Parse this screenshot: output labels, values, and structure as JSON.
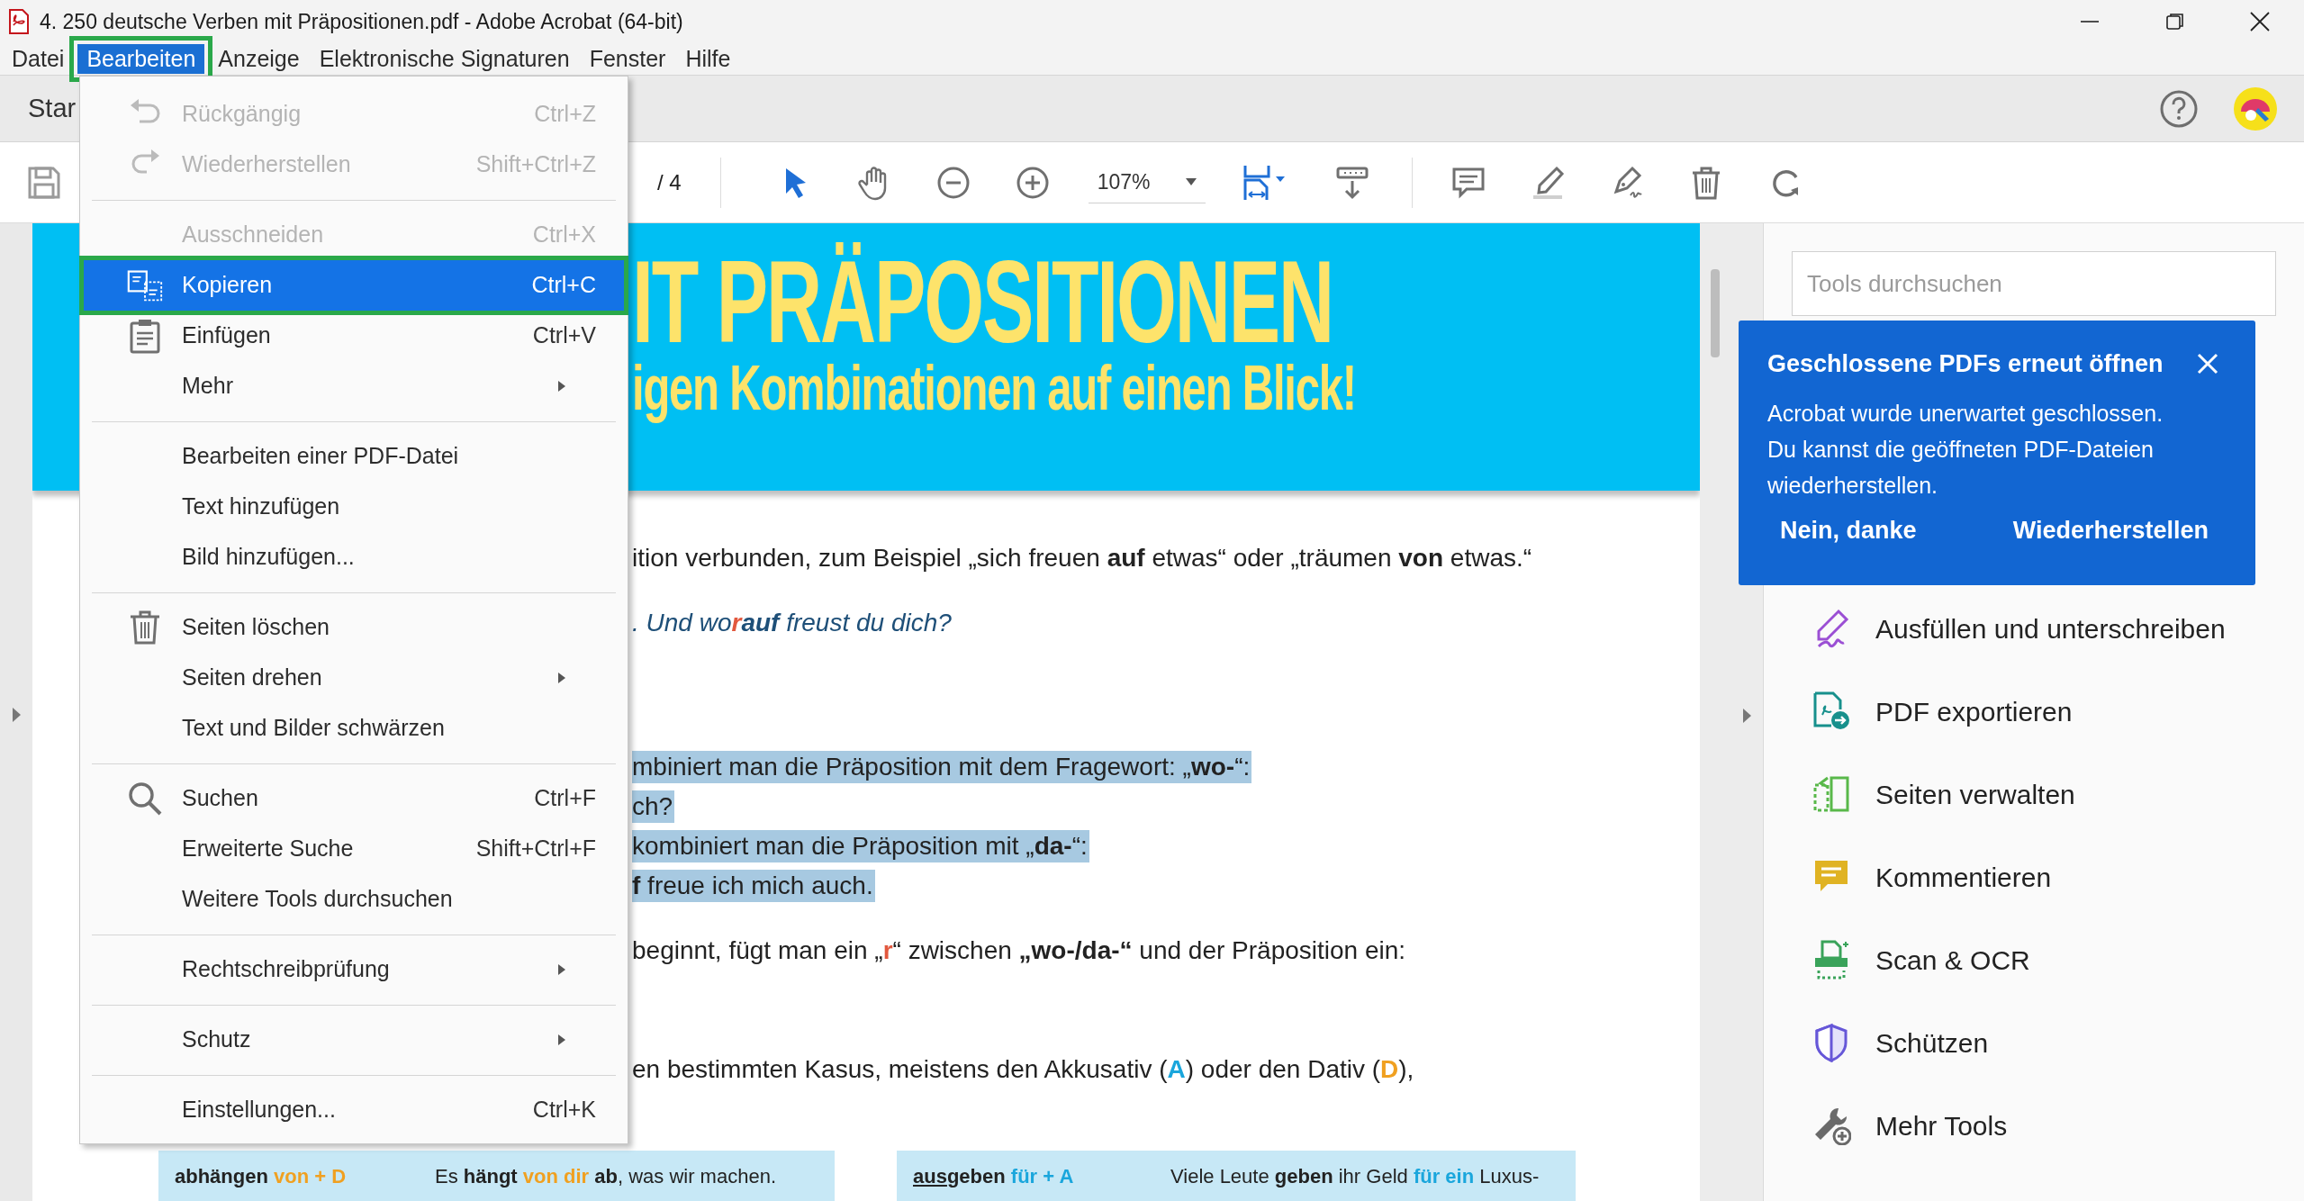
{
  "window": {
    "title": "4. 250 deutsche Verben mit Präpositionen.pdf - Adobe Acrobat (64-bit)"
  },
  "menu_bar": [
    {
      "label": "Datei",
      "selected": false
    },
    {
      "label": "Bearbeiten",
      "selected": true
    },
    {
      "label": "Anzeige",
      "selected": false
    },
    {
      "label": "Elektronische Signaturen",
      "selected": false
    },
    {
      "label": "Fenster",
      "selected": false
    },
    {
      "label": "Hilfe",
      "selected": false
    }
  ],
  "tab_bar": {
    "tab": "Star"
  },
  "toolbar": {
    "page_total": "/ 4",
    "zoom": "107%"
  },
  "edit_menu": [
    {
      "kind": "item",
      "label": "Rückgängig",
      "shortcut": "Ctrl+Z",
      "disabled": true,
      "selected": false,
      "submenu": false
    },
    {
      "kind": "item",
      "label": "Wiederherstellen",
      "shortcut": "Shift+Ctrl+Z",
      "disabled": true,
      "selected": false,
      "submenu": false
    },
    {
      "kind": "separator"
    },
    {
      "kind": "item",
      "label": "Ausschneiden",
      "shortcut": "Ctrl+X",
      "disabled": true,
      "selected": false,
      "submenu": false
    },
    {
      "kind": "item",
      "label": "Kopieren",
      "shortcut": "Ctrl+C",
      "disabled": false,
      "selected": true,
      "submenu": false
    },
    {
      "kind": "item",
      "label": "Einfügen",
      "shortcut": "Ctrl+V",
      "disabled": false,
      "selected": false,
      "submenu": false
    },
    {
      "kind": "item",
      "label": "Mehr",
      "disabled": false,
      "selected": false,
      "submenu": true
    },
    {
      "kind": "separator"
    },
    {
      "kind": "item",
      "label": "Bearbeiten einer PDF-Datei",
      "disabled": false,
      "selected": false,
      "submenu": false
    },
    {
      "kind": "item",
      "label": "Text hinzufügen",
      "disabled": false,
      "selected": false,
      "submenu": false
    },
    {
      "kind": "item",
      "label": "Bild hinzufügen...",
      "disabled": false,
      "selected": false,
      "submenu": false
    },
    {
      "kind": "separator"
    },
    {
      "kind": "item",
      "label": "Seiten löschen",
      "disabled": false,
      "selected": false,
      "submenu": false
    },
    {
      "kind": "item",
      "label": "Seiten drehen",
      "disabled": false,
      "selected": false,
      "submenu": true
    },
    {
      "kind": "item",
      "label": "Text und Bilder schwärzen",
      "disabled": false,
      "selected": false,
      "submenu": false
    },
    {
      "kind": "separator"
    },
    {
      "kind": "item",
      "label": "Suchen",
      "shortcut": "Ctrl+F",
      "disabled": false,
      "selected": false,
      "submenu": false
    },
    {
      "kind": "item",
      "label": "Erweiterte Suche",
      "shortcut": "Shift+Ctrl+F",
      "disabled": false,
      "selected": false,
      "submenu": false
    },
    {
      "kind": "item",
      "label": "Weitere Tools durchsuchen",
      "disabled": false,
      "selected": false,
      "submenu": false
    },
    {
      "kind": "separator"
    },
    {
      "kind": "item",
      "label": "Rechtschreibprüfung",
      "disabled": false,
      "selected": false,
      "submenu": true
    },
    {
      "kind": "separator"
    },
    {
      "kind": "item",
      "label": "Schutz",
      "disabled": false,
      "selected": false,
      "submenu": true
    },
    {
      "kind": "separator"
    },
    {
      "kind": "item",
      "label": "Einstellungen...",
      "shortcut": "Ctrl+K",
      "disabled": false,
      "selected": false,
      "submenu": false
    }
  ],
  "document": {
    "banner": {
      "title": "IT PRÄPOSITIONEN",
      "subtitle": "igen Kombinationen auf einen Blick!"
    },
    "blocks": [
      {
        "lines": [
          {
            "kind": "text",
            "highlighted": false,
            "segments": [
              {
                "text": "ition verbunden, zum Beispiel „sich freuen ",
                "kind": "plain"
              },
              {
                "text": "auf",
                "kind": "bold"
              },
              {
                "text": " etwas“ oder „träumen ",
                "kind": "plain"
              },
              {
                "text": "von",
                "kind": "bold"
              },
              {
                "text": " etwas.“",
                "kind": "plain"
              }
            ]
          }
        ]
      },
      {
        "lines": [
          {
            "kind": "example",
            "highlighted": false,
            "segments": [
              {
                "text": ". Und wo",
                "kind": "plain"
              },
              {
                "text": "r",
                "kind": "red"
              },
              {
                "text": "auf",
                "kind": "bold"
              },
              {
                "text": " freust du dich?",
                "kind": "plain"
              }
            ]
          }
        ]
      },
      {
        "lines": [
          {
            "kind": "text",
            "highlighted": true,
            "segments": [
              {
                "text": "mbiniert man die Präposition mit dem Fragewort: „",
                "kind": "plain"
              },
              {
                "text": "wo-",
                "kind": "bold"
              },
              {
                "text": "“:",
                "kind": "plain"
              }
            ]
          },
          {
            "kind": "text",
            "highlighted": true,
            "segments": [
              {
                "text": "ch?",
                "kind": "plain"
              }
            ]
          },
          {
            "kind": "text",
            "highlighted": true,
            "segments": [
              {
                "text": "kombiniert man die Präposition mit „",
                "kind": "plain"
              },
              {
                "text": "da-",
                "kind": "bold"
              },
              {
                "text": "“:",
                "kind": "plain"
              }
            ]
          },
          {
            "kind": "text",
            "highlighted": true,
            "segments": [
              {
                "text": "f",
                "kind": "bold"
              },
              {
                "text": " freue ich mich auch.",
                "kind": "plain"
              }
            ]
          }
        ]
      },
      {
        "lines": [
          {
            "kind": "text",
            "highlighted": false,
            "segments": [
              {
                "text": "beginnt, fügt man ein „",
                "kind": "plain"
              },
              {
                "text": "r",
                "kind": "red"
              },
              {
                "text": "“ zwischen ",
                "kind": "plain"
              },
              {
                "text": "„wo-/da-“",
                "kind": "bold"
              },
              {
                "text": " und der Präposition ein:",
                "kind": "plain"
              }
            ]
          }
        ]
      },
      {
        "lines": [
          {
            "kind": "text",
            "highlighted": false,
            "segments": [
              {
                "text": "en bestimmten Kasus, meistens den Akkusativ (",
                "kind": "plain"
              },
              {
                "text": "A",
                "kind": "blue"
              },
              {
                "text": ") oder den Dativ (",
                "kind": "plain"
              },
              {
                "text": "D",
                "kind": "orange"
              },
              {
                "text": "),",
                "kind": "plain"
              }
            ]
          }
        ]
      }
    ],
    "cards": [
      {
        "term": [
          {
            "text": "abhängen ",
            "kind": "bold"
          },
          {
            "text": "von + D",
            "kind": "orange"
          }
        ],
        "example": [
          {
            "text": "Es ",
            "kind": "plain"
          },
          {
            "text": "hängt",
            "kind": "bold"
          },
          {
            "text": " von dir ",
            "kind": "orange"
          },
          {
            "text": "ab",
            "kind": "bold"
          },
          {
            "text": ", was wir machen.",
            "kind": "plain"
          }
        ]
      },
      {
        "term": [
          {
            "text": "aus",
            "kind": "bold_underline"
          },
          {
            "text": "geben ",
            "kind": "bold"
          },
          {
            "text": "für + A",
            "kind": "blue"
          }
        ],
        "example": [
          {
            "text": "Viele Leute ",
            "kind": "plain"
          },
          {
            "text": "geben",
            "kind": "bold"
          },
          {
            "text": " ihr Geld ",
            "kind": "plain"
          },
          {
            "text": "für ein",
            "kind": "blue"
          },
          {
            "text": " Luxus-",
            "kind": "plain"
          }
        ]
      }
    ]
  },
  "notification": {
    "title": "Geschlossene PDFs erneut öffnen",
    "message": "Acrobat wurde unerwartet geschlossen. Du kannst die geöffneten PDF-Dateien wiederherstellen.",
    "buttons": [
      "Nein, danke",
      "Wiederherstellen"
    ]
  },
  "tools_panel": {
    "search": {
      "placeholder": "Tools durchsuchen"
    },
    "tools": [
      {
        "label": "Ausfüllen und unterschreiben"
      },
      {
        "label": "PDF exportieren"
      },
      {
        "label": "Seiten verwalten"
      },
      {
        "label": "Kommentieren"
      },
      {
        "label": "Scan & OCR"
      },
      {
        "label": "Schützen"
      },
      {
        "label": "Mehr Tools"
      }
    ]
  }
}
